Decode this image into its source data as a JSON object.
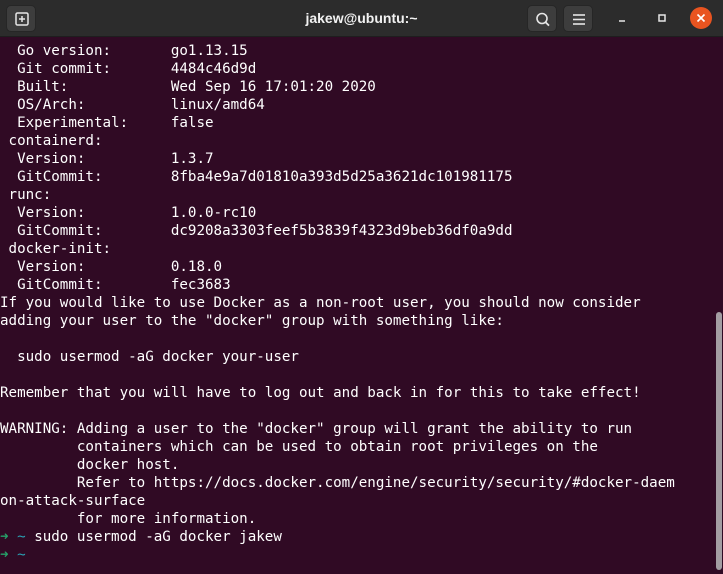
{
  "window": {
    "title": "jakew@ubuntu:~"
  },
  "header": {
    "new_tab_icon": "new-tab-icon",
    "search_icon": "search-icon",
    "menu_icon": "hamburger-menu-icon"
  },
  "window_controls": {
    "minimize_icon": "minimize-icon",
    "maximize_icon": "maximize-icon",
    "close_icon": "close-icon",
    "close_bg": "#e95420"
  },
  "colors": {
    "terminal_bg": "#300a24",
    "prompt_arrow": "#26a269",
    "prompt_dir": "#2aa1b3"
  },
  "terminal": {
    "lines": [
      "  Go version:       go1.13.15",
      "  Git commit:       4484c46d9d",
      "  Built:            Wed Sep 16 17:01:20 2020",
      "  OS/Arch:          linux/amd64",
      "  Experimental:     false",
      " containerd:",
      "  Version:          1.3.7",
      "  GitCommit:        8fba4e9a7d01810a393d5d25a3621dc101981175",
      " runc:",
      "  Version:          1.0.0-rc10",
      "  GitCommit:        dc9208a3303feef5b3839f4323d9beb36df0a9dd",
      " docker-init:",
      "  Version:          0.18.0",
      "  GitCommit:        fec3683",
      "If you would like to use Docker as a non-root user, you should now consider",
      "adding your user to the \"docker\" group with something like:",
      "",
      "  sudo usermod -aG docker your-user",
      "",
      "Remember that you will have to log out and back in for this to take effect!",
      "",
      "WARNING: Adding a user to the \"docker\" group will grant the ability to run",
      "         containers which can be used to obtain root privileges on the",
      "         docker host.",
      "         Refer to https://docs.docker.com/engine/security/security/#docker-daem",
      "on-attack-surface",
      "         for more information."
    ],
    "prompts": [
      {
        "arrow": "➜",
        "dir": "~",
        "command": "sudo usermod -aG docker jakew"
      },
      {
        "arrow": "➜",
        "dir": "~",
        "command": ""
      }
    ]
  }
}
